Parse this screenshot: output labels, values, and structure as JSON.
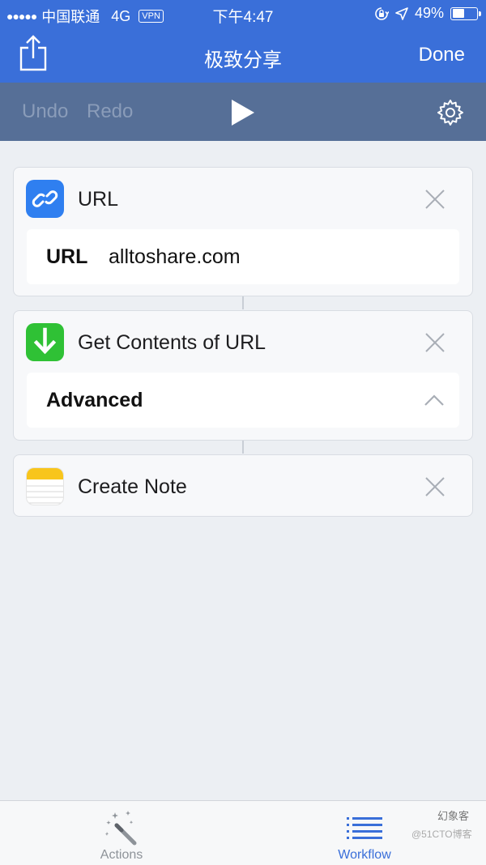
{
  "status_bar": {
    "signal": "●●●●●",
    "carrier": "中国联通",
    "network": "4G",
    "vpn": "VPN",
    "time": "下午4:47",
    "battery": "49%",
    "battery_level": 0.49
  },
  "nav": {
    "title": "极致分享",
    "done_label": "Done"
  },
  "toolbar": {
    "undo_label": "Undo",
    "redo_label": "Redo"
  },
  "actions": [
    {
      "title": "URL",
      "icon": "link-icon",
      "color": "#2f7ff0",
      "field_label": "URL",
      "field_value": "alltoshare.com"
    },
    {
      "title": "Get Contents of URL",
      "icon": "download-arrow-icon",
      "color": "#2fc135",
      "field_label": "Advanced"
    },
    {
      "title": "Create Note",
      "icon": "notes-icon",
      "color": "#f8c51c"
    }
  ],
  "tabs": [
    {
      "label": "Actions",
      "icon": "magic-wand-icon"
    },
    {
      "label": "Workflow",
      "icon": "list-icon"
    }
  ],
  "watermark": {
    "top": "幻象客",
    "bottom": "@51CTO博客"
  }
}
